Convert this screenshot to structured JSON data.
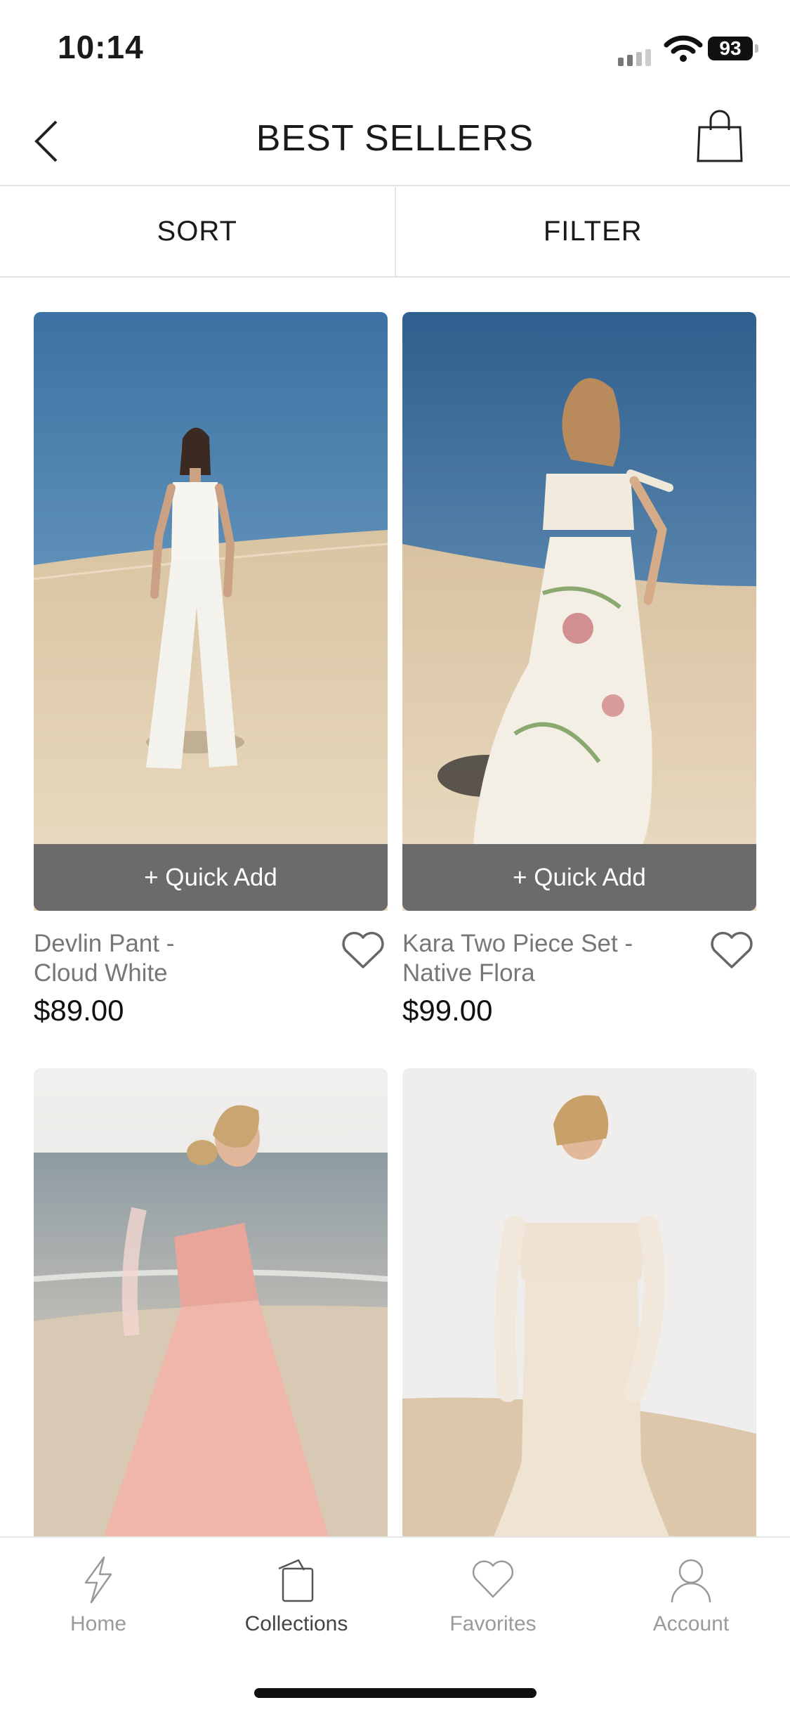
{
  "status_bar": {
    "time": "10:14",
    "battery": "93"
  },
  "header": {
    "title": "BEST SELLERS",
    "back_icon": "chevron-left-icon",
    "cart_icon": "shopping-bag-icon"
  },
  "toolbar": {
    "sort_label": "SORT",
    "filter_label": "FILTER"
  },
  "products": [
    {
      "name_line1": "Devlin Pant -",
      "name_line2": "Cloud White",
      "price": "$89.00",
      "quick_add": "+ Quick Add",
      "favorite_icon": "heart-outline-icon"
    },
    {
      "name_line1": "Kara Two Piece Set -",
      "name_line2": "Native Flora",
      "price": "$99.00",
      "quick_add": "+ Quick Add",
      "favorite_icon": "heart-outline-icon"
    },
    {
      "image": "pink-tulle-dress-beach"
    },
    {
      "image": "cream-off-shoulder-dress-dunes"
    }
  ],
  "tabbar": {
    "items": [
      {
        "label": "Home",
        "icon": "lightning-icon",
        "active": false
      },
      {
        "label": "Collections",
        "icon": "cards-icon",
        "active": true
      },
      {
        "label": "Favorites",
        "icon": "heart-icon",
        "active": false
      },
      {
        "label": "Account",
        "icon": "person-icon",
        "active": false
      }
    ]
  },
  "colors": {
    "quick_add_bg": "#6b6b6b",
    "divider": "#e2e2e2",
    "sky": "#3f78a6",
    "sand": "#e8d8bf"
  }
}
